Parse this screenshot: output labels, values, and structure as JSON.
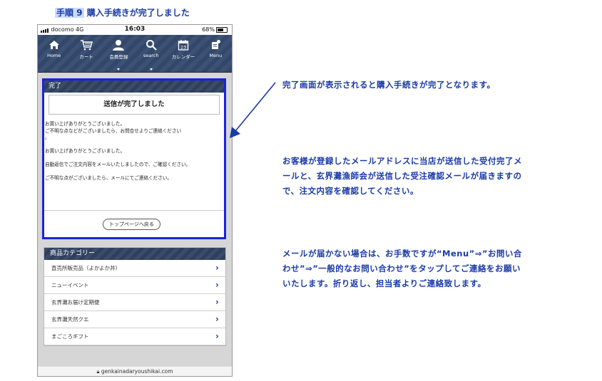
{
  "step": {
    "label": "手順 9",
    "title": "購入手続きが完了しました"
  },
  "statusbar": {
    "carrier": "docomo  4G",
    "time": "16:03",
    "battery": "68%"
  },
  "nav": [
    {
      "label": "Home",
      "icon": "home-icon"
    },
    {
      "label": "カート",
      "icon": "cart-icon"
    },
    {
      "label": "会員登録",
      "icon": "user-icon"
    },
    {
      "label": "search",
      "icon": "search-icon"
    },
    {
      "label": "カレンダー",
      "icon": "calendar-icon",
      "day": "23"
    },
    {
      "label": "Menu",
      "icon": "menu-icon"
    }
  ],
  "complete": {
    "header": "完了",
    "title": "送信が完了しました",
    "messages": [
      "お買い上げありがとうございました。",
      "ご不明な点などがございましたら、お問合せよりご連絡ください",
      "。",
      "お買い上げありがとうございました。",
      "自動返信でご注文内容をメールいたしましたので、ご確認ください。",
      "ご不明な点がございましたら、メールにてご連絡ください。"
    ],
    "button": "トップページへ戻る"
  },
  "categories": {
    "header": "商品カテゴリー",
    "items": [
      "直売所販売品（よかよか丼）",
      "ニューイベント",
      "玄界灘お届け定期便",
      "玄界灘天然クエ",
      "まごころギフト"
    ]
  },
  "url": "genkainadaryoushikai.com",
  "notes": {
    "note1": "完了画面が表示されると購入手続きが完了となります。",
    "note2": "お客様が登録したメールアドレスに当店が送信した受付完了メールと、玄界灘漁師会が送信した受注確認メールが届きますので、注文内容を確認してください。",
    "note3": "メールが届かない場合は、お手数ですが“Menu”⇒”お問い合わせ”⇒”一般的なお問い合わせ”をタップしてご連絡をお願いいたします。折り返し、担当者よりご連絡致します。"
  },
  "colors": {
    "accent": "#1a3aa8",
    "highlight_border": "#1a22e0",
    "nav_bg": "#3c5275"
  }
}
